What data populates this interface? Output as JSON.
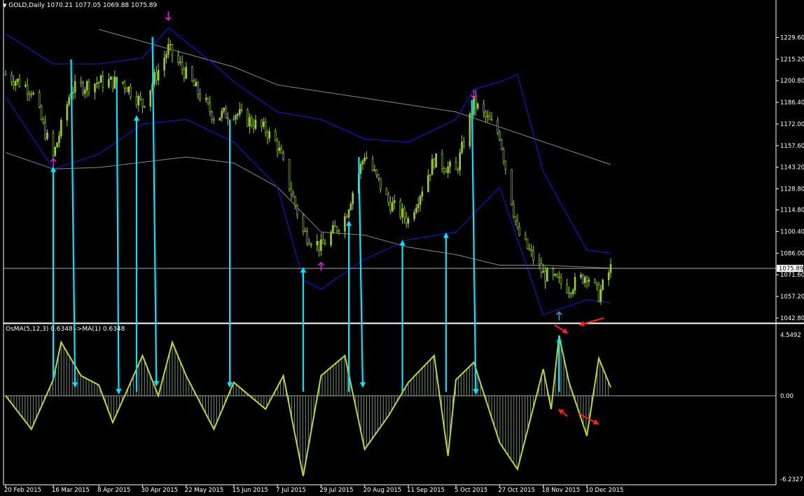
{
  "header": {
    "symbol": "GOLD,Daily",
    "ohlc": "1070.21 1077.05 1069.88 1075.89",
    "osma_title": "OsMA(5,12,3) 0.6348 ->MA(1) 0.6348"
  },
  "colors": {
    "background": "#000000",
    "candles": "#9ACD32",
    "bollinger": "#1a1ad6",
    "moving_average": "#8a8a8a",
    "arrows": "#00e5ff",
    "signal_marks": "#cc33cc",
    "red_marks": "#ff2020",
    "osma_line": "#b8d840",
    "histogram": "#7a8a7a",
    "axis_text": "#ffffff"
  },
  "chart_data": [
    {
      "type": "candlestick",
      "title": "GOLD,Daily",
      "y_ticks": [
        "1229.60",
        "1215.20",
        "1200.80",
        "1186.40",
        "1172.00",
        "1157.60",
        "1143.20",
        "1128.80",
        "1114.80",
        "1100.40",
        "1086.00",
        "1071.60",
        "1057.20",
        "1042.80"
      ],
      "y_range": [
        1040,
        1248
      ],
      "current_price": "1075.89",
      "x_ticks": [
        "20 Feb 2015",
        "16 Mar 2015",
        "8 Apr 2015",
        "30 Apr 2015",
        "22 May 2015",
        "15 Jun 2015",
        "7 Jul 2015",
        "29 Jul 2015",
        "20 Aug 2015",
        "11 Sep 2015",
        "5 Oct 2015",
        "27 Oct 2015",
        "18 Nov 2015",
        "10 Dec 2015"
      ],
      "approx_close_path": [
        [
          "20 Feb 2015",
          1205
        ],
        [
          "5 Mar 2015",
          1195
        ],
        [
          "16 Mar 2015",
          1150
        ],
        [
          "25 Mar 2015",
          1195
        ],
        [
          "8 Apr 2015",
          1200
        ],
        [
          "20 Apr 2015",
          1200
        ],
        [
          "30 Apr 2015",
          1185
        ],
        [
          "13 May 2015",
          1222
        ],
        [
          "22 May 2015",
          1205
        ],
        [
          "5 Jun 2015",
          1177
        ],
        [
          "15 Jun 2015",
          1180
        ],
        [
          "1 Jul 2015",
          1168
        ],
        [
          "7 Jul 2015",
          1158
        ],
        [
          "20 Jul 2015",
          1100
        ],
        [
          "29 Jul 2015",
          1090
        ],
        [
          "10 Aug 2015",
          1110
        ],
        [
          "20 Aug 2015",
          1152
        ],
        [
          "1 Sep 2015",
          1120
        ],
        [
          "11 Sep 2015",
          1108
        ],
        [
          "24 Sep 2015",
          1148
        ],
        [
          "5 Oct 2015",
          1140
        ],
        [
          "14 Oct 2015",
          1186
        ],
        [
          "27 Oct 2015",
          1165
        ],
        [
          "5 Nov 2015",
          1100
        ],
        [
          "18 Nov 2015",
          1072
        ],
        [
          "1 Dec 2015",
          1063
        ],
        [
          "10 Dec 2015",
          1072
        ],
        [
          "16 Dec 2015",
          1058
        ],
        [
          "22 Dec 2015",
          1075.89
        ]
      ],
      "bollinger_upper": [
        [
          "20 Feb 2015",
          1232
        ],
        [
          "16 Mar 2015",
          1212
        ],
        [
          "8 Apr 2015",
          1212
        ],
        [
          "30 Apr 2015",
          1216
        ],
        [
          "13 May 2015",
          1236
        ],
        [
          "5 Jun 2015",
          1212
        ],
        [
          "15 Jun 2015",
          1200
        ],
        [
          "7 Jul 2015",
          1180
        ],
        [
          "29 Jul 2015",
          1175
        ],
        [
          "20 Aug 2015",
          1162
        ],
        [
          "11 Sep 2015",
          1160
        ],
        [
          "5 Oct 2015",
          1175
        ],
        [
          "14 Oct 2015",
          1195
        ],
        [
          "27 Oct 2015",
          1200
        ],
        [
          "5 Nov 2015",
          1205
        ],
        [
          "18 Nov 2015",
          1140
        ],
        [
          "10 Dec 2015",
          1088
        ],
        [
          "22 Dec 2015",
          1086
        ]
      ],
      "bollinger_lower": [
        [
          "20 Feb 2015",
          1190
        ],
        [
          "16 Mar 2015",
          1142
        ],
        [
          "8 Apr 2015",
          1152
        ],
        [
          "30 Apr 2015",
          1172
        ],
        [
          "22 May 2015",
          1175
        ],
        [
          "15 Jun 2015",
          1160
        ],
        [
          "7 Jul 2015",
          1130
        ],
        [
          "20 Jul 2015",
          1068
        ],
        [
          "29 Jul 2015",
          1062
        ],
        [
          "20 Aug 2015",
          1082
        ],
        [
          "11 Sep 2015",
          1095
        ],
        [
          "5 Oct 2015",
          1100
        ],
        [
          "27 Oct 2015",
          1130
        ],
        [
          "18 Nov 2015",
          1045
        ],
        [
          "10 Dec 2015",
          1055
        ],
        [
          "22 Dec 2015",
          1053
        ]
      ],
      "moving_average": [
        [
          "20 Feb 2015",
          1153
        ],
        [
          "16 Mar 2015",
          1142
        ],
        [
          "8 Apr 2015",
          1143
        ],
        [
          "22 May 2015",
          1150
        ],
        [
          "15 Jun 2015",
          1146
        ],
        [
          "7 Jul 2015",
          1130
        ],
        [
          "29 Jul 2015",
          1100
        ],
        [
          "20 Aug 2015",
          1098
        ],
        [
          "11 Sep 2015",
          1090
        ],
        [
          "5 Oct 2015",
          1085
        ],
        [
          "27 Oct 2015",
          1078
        ],
        [
          "18 Nov 2015",
          1078
        ],
        [
          "22 Dec 2015",
          1076
        ]
      ],
      "slow_moving_average": [
        [
          "8 Apr 2015",
          1235
        ],
        [
          "15 Jun 2015",
          1210
        ],
        [
          "7 Jul 2015",
          1198
        ],
        [
          "5 Oct 2015",
          1180
        ],
        [
          "27 Oct 2015",
          1170
        ],
        [
          "22 Dec 2015",
          1145
        ]
      ]
    },
    {
      "type": "line",
      "title": "OsMA(5,12,3) 0.6348 ->MA(1) 0.6348",
      "y_ticks": [
        "4.5492",
        "0.00",
        "-6.2327"
      ],
      "y_range": [
        -6.2327,
        4.5492
      ],
      "approx_path": [
        [
          "20 Feb 2015",
          0.0
        ],
        [
          "5 Mar 2015",
          -2.5
        ],
        [
          "16 Mar 2015",
          1.2
        ],
        [
          "20 Mar 2015",
          4.0
        ],
        [
          "30 Mar 2015",
          1.5
        ],
        [
          "8 Apr 2015",
          0.8
        ],
        [
          "15 Apr 2015",
          -2.0
        ],
        [
          "30 Apr 2015",
          3.0
        ],
        [
          "8 May 2015",
          0.0
        ],
        [
          "15 May 2015",
          4.0
        ],
        [
          "22 May 2015",
          1.5
        ],
        [
          "5 Jun 2015",
          -2.5
        ],
        [
          "15 Jun 2015",
          1.0
        ],
        [
          "1 Jul 2015",
          -1.0
        ],
        [
          "10 Jul 2015",
          1.5
        ],
        [
          "20 Jul 2015",
          -6.0
        ],
        [
          "29 Jul 2015",
          1.5
        ],
        [
          "10 Aug 2015",
          3.0
        ],
        [
          "20 Aug 2015",
          -4.0
        ],
        [
          "1 Sep 2015",
          -1.5
        ],
        [
          "11 Sep 2015",
          1.0
        ],
        [
          "24 Sep 2015",
          3.0
        ],
        [
          "1 Oct 2015",
          -4.5
        ],
        [
          "5 Oct 2015",
          1.2
        ],
        [
          "14 Oct 2015",
          2.5
        ],
        [
          "27 Oct 2015",
          -3.5
        ],
        [
          "5 Nov 2015",
          -5.5
        ],
        [
          "18 Nov 2015",
          2.0
        ],
        [
          "22 Nov 2015",
          -1.0
        ],
        [
          "26 Nov 2015",
          4.5
        ],
        [
          "1 Dec 2015",
          1.0
        ],
        [
          "10 Dec 2015",
          -3.0
        ],
        [
          "16 Dec 2015",
          2.8
        ],
        [
          "22 Dec 2015",
          0.63
        ]
      ]
    }
  ],
  "annotations": {
    "arrows": [
      {
        "from": [
          "16 Mar 2015",
          1.2
        ],
        "to": [
          "16 Mar 2015",
          1142
        ],
        "direction": "up"
      },
      {
        "from": [
          "25 Mar 2015",
          1215
        ],
        "to": [
          "27 Mar 2015",
          0.8
        ],
        "direction": "down"
      },
      {
        "from": [
          "17 Apr 2015",
          1203
        ],
        "to": [
          "18 Apr 2015",
          0.3
        ],
        "direction": "down"
      },
      {
        "from": [
          "27 Apr 2015",
          0.3
        ],
        "to": [
          "27 Apr 2015",
          1176
        ],
        "direction": "up"
      },
      {
        "from": [
          "5 May 2015",
          1230
        ],
        "to": [
          "7 May 2015",
          0.9
        ],
        "direction": "down"
      },
      {
        "from": [
          "13 Jun 2015",
          1175
        ],
        "to": [
          "13 Jun 2015",
          0.8
        ],
        "direction": "down"
      },
      {
        "from": [
          "20 Jul 2015",
          0.3
        ],
        "to": [
          "20 Jul 2015",
          1075
        ],
        "direction": "up"
      },
      {
        "from": [
          "12 Aug 2015",
          0.3
        ],
        "to": [
          "12 Aug 2015",
          1106
        ],
        "direction": "up"
      },
      {
        "from": [
          "17 Aug 2015",
          1150
        ],
        "to": [
          "19 Aug 2015",
          0.8
        ],
        "direction": "down"
      },
      {
        "from": [
          "8 Sep 2015",
          0.3
        ],
        "to": [
          "8 Sep 2015",
          1093
        ],
        "direction": "up"
      },
      {
        "from": [
          "30 Sep 2015",
          0.3
        ],
        "to": [
          "30 Sep 2015",
          1098
        ],
        "direction": "up"
      },
      {
        "from": [
          "13 Oct 2015",
          1188
        ],
        "to": [
          "15 Oct 2015",
          0.3
        ],
        "direction": "down"
      },
      {
        "from": [
          "26 Nov 2015",
          0.3
        ],
        "to": [
          "26 Nov 2015",
          4.2
        ],
        "direction": "up"
      }
    ],
    "signal_marks": [
      {
        "at": [
          "16 Mar 2015",
          1146
        ],
        "kind": "up"
      },
      {
        "at": [
          "13 May 2015",
          1244
        ],
        "kind": "down"
      },
      {
        "at": [
          "29 Jul 2015",
          1077
        ],
        "kind": "up"
      },
      {
        "at": [
          "14 Oct 2015",
          1192
        ],
        "kind": "down"
      },
      {
        "at": [
          "26 Nov 2015",
          1044
        ],
        "kind": "up-blue"
      }
    ]
  }
}
